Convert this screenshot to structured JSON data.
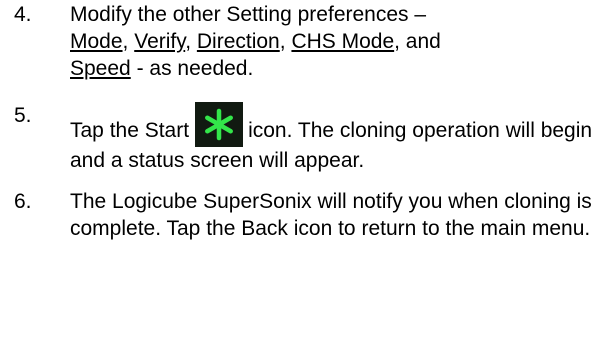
{
  "steps": [
    {
      "number": "4.",
      "text_before": "Modify the other Setting preferences –",
      "links": [
        "Mode",
        "Verify",
        "Direction",
        "CHS Mode",
        "Speed"
      ],
      "sep_comma": ",",
      "sep_and": ", and",
      "text_after": " - as needed."
    },
    {
      "number": "5.",
      "text_before": "Tap the Start",
      "icon": "start-asterisk-icon",
      "text_after": "icon. The cloning operation will begin and a status screen will appear."
    },
    {
      "number": "6.",
      "text": "The Logicube SuperSonix will notify you when cloning is complete. Tap the Back icon to return to the main menu."
    }
  ],
  "colors": {
    "text": "#000000",
    "icon_bg": "#111a11",
    "icon_fg": "#33e64a"
  }
}
